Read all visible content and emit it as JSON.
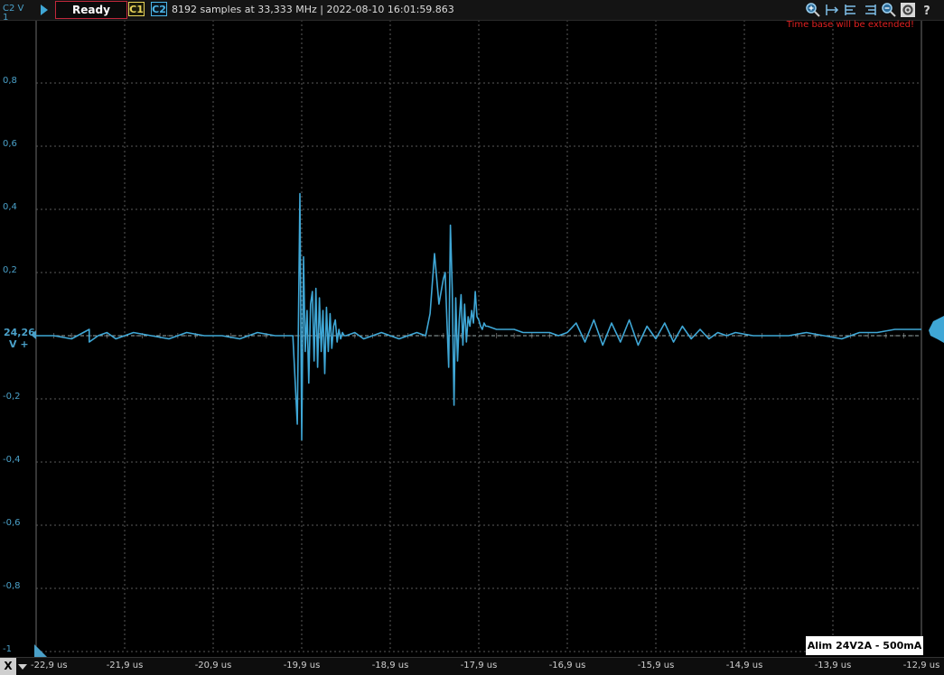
{
  "toolbar": {
    "channel_label": "C2 V",
    "status": "Ready",
    "c1": "C1",
    "c2": "C2",
    "acquisition_info": "8192 samples at 33,333 MHz | 2022-08-10 16:01:59.863",
    "tools": [
      "zoom-in-icon",
      "zoom-fit-icon",
      "align-left-icon",
      "align-right-icon",
      "zoom-out-icon",
      "settings-icon",
      "help-icon"
    ]
  },
  "warning": "Time base will be extended!",
  "offset": {
    "value": "24,26",
    "unit": "V +"
  },
  "legend": "Alim 24V2A - 500mA",
  "x_button": "X",
  "colors": {
    "trace": "#3fa7d6",
    "grid": "#5a5a5a",
    "axis_label": "#4aa0c8",
    "warning": "#e02020"
  },
  "chart_data": {
    "type": "line",
    "ylim": [
      -1,
      1
    ],
    "yticks": [
      "1",
      "0,8",
      "0,6",
      "0,4",
      "0,2",
      "",
      "-0,2",
      "-0,4",
      "-0,6",
      "-0,8",
      "-1"
    ],
    "xlim": [
      -22.9,
      -12.9
    ],
    "xticks": [
      "-22,9 us",
      "-21,9 us",
      "-20,9 us",
      "-19,9 us",
      "-18,9 us",
      "-17,9 us",
      "-16,9 us",
      "-15,9 us",
      "-14,9 us",
      "-13,9 us",
      "-12,9 us"
    ],
    "grid": true,
    "series": [
      {
        "x": [
          -22.9,
          -22.7,
          -22.5,
          -22.3,
          -22.3,
          -22.2,
          -22.1,
          -22.0,
          -21.8,
          -21.6,
          -21.4,
          -21.2,
          -21.0,
          -20.8,
          -20.6,
          -20.4,
          -20.2,
          -20.0,
          -19.95,
          -19.92,
          -19.9,
          -19.88,
          -19.86,
          -19.84,
          -19.82,
          -19.8,
          -19.78,
          -19.76,
          -19.74,
          -19.72,
          -19.7,
          -19.68,
          -19.66,
          -19.64,
          -19.62,
          -19.6,
          -19.58,
          -19.56,
          -19.54,
          -19.52,
          -19.5,
          -19.48,
          -19.46,
          -19.44,
          -19.42,
          -19.4,
          -19.3,
          -19.2,
          -19.1,
          -19.0,
          -18.9,
          -18.8,
          -18.7,
          -18.6,
          -18.5,
          -18.45,
          -18.4,
          -18.35,
          -18.3,
          -18.28,
          -18.26,
          -18.24,
          -18.22,
          -18.2,
          -18.18,
          -18.16,
          -18.14,
          -18.12,
          -18.1,
          -18.08,
          -18.06,
          -18.04,
          -18.02,
          -18.0,
          -17.98,
          -17.96,
          -17.94,
          -17.92,
          -17.9,
          -17.88,
          -17.86,
          -17.84,
          -17.82,
          -17.8,
          -17.7,
          -17.6,
          -17.5,
          -17.4,
          -17.3,
          -17.2,
          -17.1,
          -17.0,
          -16.9,
          -16.8,
          -16.7,
          -16.6,
          -16.5,
          -16.4,
          -16.3,
          -16.2,
          -16.1,
          -16.0,
          -15.9,
          -15.8,
          -15.7,
          -15.6,
          -15.5,
          -15.4,
          -15.3,
          -15.2,
          -15.1,
          -15.0,
          -14.8,
          -14.6,
          -14.4,
          -14.2,
          -14.0,
          -13.8,
          -13.6,
          -13.4,
          -13.2,
          -13.0,
          -12.9
        ],
        "y": [
          0.0,
          0.0,
          -0.01,
          0.02,
          -0.02,
          0.0,
          0.01,
          -0.01,
          0.01,
          0.0,
          -0.01,
          0.01,
          0.0,
          0.0,
          -0.01,
          0.01,
          0.0,
          0.0,
          -0.28,
          0.45,
          -0.33,
          0.25,
          -0.05,
          0.08,
          -0.15,
          0.1,
          0.14,
          -0.08,
          0.15,
          -0.1,
          0.12,
          -0.05,
          0.08,
          -0.12,
          0.09,
          -0.05,
          0.07,
          -0.04,
          0.03,
          0.05,
          -0.02,
          0.02,
          -0.01,
          0.01,
          0.0,
          0.0,
          0.01,
          -0.01,
          0.0,
          0.01,
          0.0,
          -0.01,
          0.0,
          0.01,
          0.0,
          0.07,
          0.26,
          0.1,
          0.18,
          0.2,
          0.05,
          -0.1,
          0.35,
          0.15,
          -0.22,
          0.12,
          -0.08,
          0.05,
          0.13,
          -0.03,
          0.1,
          -0.02,
          0.06,
          0.03,
          0.08,
          0.04,
          0.14,
          0.06,
          0.05,
          0.03,
          0.02,
          0.04,
          0.03,
          0.03,
          0.02,
          0.02,
          0.02,
          0.01,
          0.01,
          0.01,
          0.01,
          0.0,
          0.01,
          0.04,
          -0.02,
          0.05,
          -0.03,
          0.04,
          -0.02,
          0.05,
          -0.03,
          0.03,
          -0.01,
          0.04,
          -0.02,
          0.03,
          -0.01,
          0.02,
          -0.01,
          0.01,
          0.0,
          0.01,
          0.0,
          0.0,
          0.0,
          0.01,
          0.0,
          -0.01,
          0.01,
          0.01,
          0.02,
          0.02,
          0.02
        ]
      }
    ]
  }
}
